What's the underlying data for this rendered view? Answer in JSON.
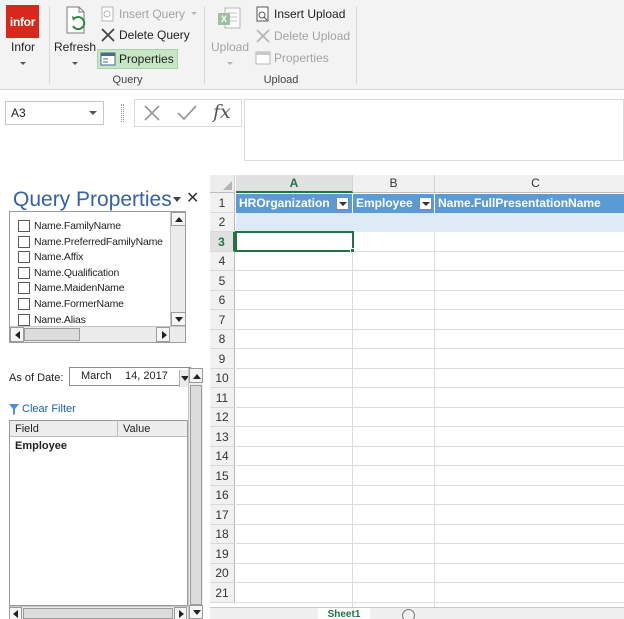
{
  "ribbon": {
    "infor": {
      "logo_text": "infor",
      "label": "Infor"
    },
    "refresh": {
      "label": "Refresh"
    },
    "query": {
      "insert_query": "Insert Query",
      "delete_query": "Delete Query",
      "properties": "Properties",
      "group_label": "Query"
    },
    "upload": {
      "upload": "Upload",
      "insert_upload": "Insert Upload",
      "delete_upload": "Delete Upload",
      "properties": "Properties",
      "group_label": "Upload"
    }
  },
  "formula_bar": {
    "name_box": "A3",
    "fx_symbol": "fx",
    "formula_value": ""
  },
  "query_pane": {
    "title": "Query Properties",
    "fields": [
      {
        "label": "Name.FamilyName",
        "checked": false
      },
      {
        "label": "Name.PreferredFamilyName",
        "checked": false
      },
      {
        "label": "Name.Affix",
        "checked": false
      },
      {
        "label": "Name.Qualification",
        "checked": false
      },
      {
        "label": "Name.MaidenName",
        "checked": false
      },
      {
        "label": "Name.FormerName",
        "checked": false
      },
      {
        "label": "Name.Alias",
        "checked": false
      }
    ],
    "as_of_date_label": "As of Date:",
    "date_month": "March",
    "date_day_year": "14, 2017",
    "clear_filter": "Clear Filter",
    "filter_grid": {
      "columns": [
        "Field",
        "Value"
      ],
      "rows": [
        {
          "field": "Employee",
          "value": ""
        }
      ]
    }
  },
  "sheet": {
    "columns": [
      "A",
      "B",
      "C"
    ],
    "active_column": "A",
    "active_row": "3",
    "rows": [
      "1",
      "2",
      "3",
      "4",
      "5",
      "6",
      "7",
      "8",
      "9",
      "10",
      "11",
      "12",
      "13",
      "14",
      "15",
      "16",
      "17",
      "18",
      "19",
      "20",
      "21"
    ],
    "table_headers": [
      "HROrganization",
      "Employee",
      "Name.FullPresentationName"
    ],
    "tab_name": "Sheet1"
  },
  "colors": {
    "accent_green": "#217346",
    "table_header_blue": "#5b9bd5",
    "table_band_blue": "#ddebf7",
    "infor_red": "#d6281c",
    "pane_title_blue": "#3561a8"
  }
}
